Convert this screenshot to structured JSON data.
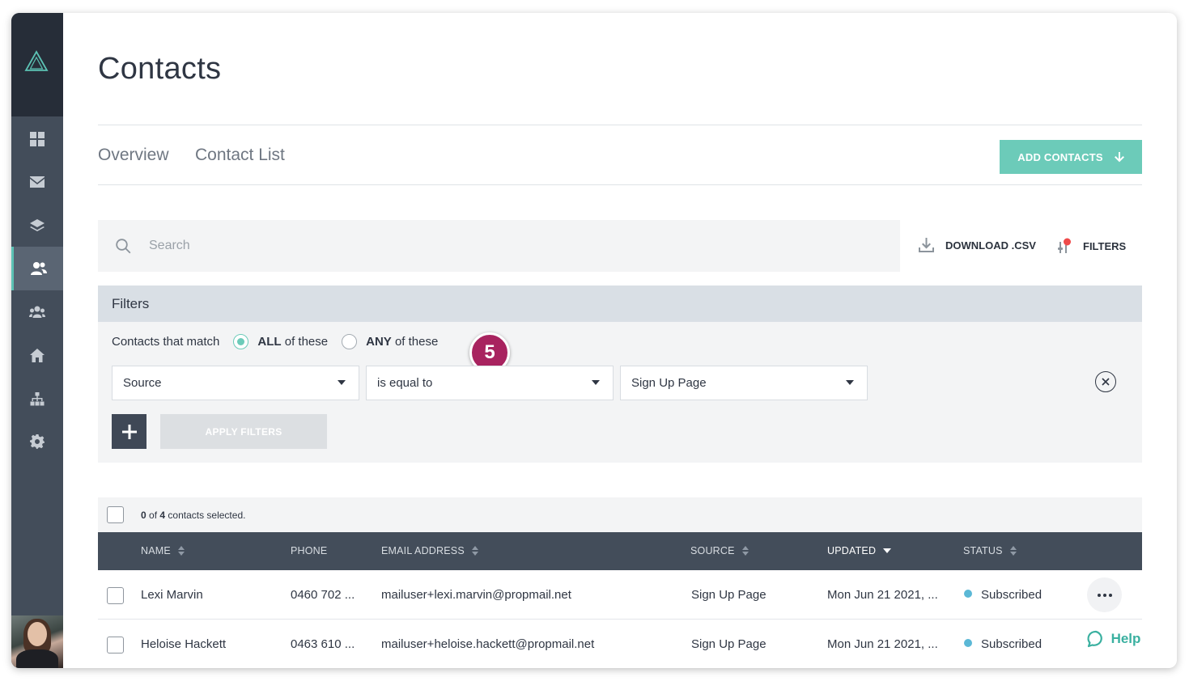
{
  "page": {
    "title": "Contacts",
    "tabs": [
      {
        "label": "Overview"
      },
      {
        "label": "Contact List"
      }
    ],
    "add_contacts_label": "ADD CONTACTS"
  },
  "sidebar": {
    "items": [
      {
        "icon": "dashboard-icon"
      },
      {
        "icon": "mail-icon"
      },
      {
        "icon": "layers-icon"
      },
      {
        "icon": "contacts-icon",
        "active": true
      },
      {
        "icon": "groups-icon"
      },
      {
        "icon": "home-icon"
      },
      {
        "icon": "sitemap-icon"
      },
      {
        "icon": "gear-icon"
      }
    ]
  },
  "toolbar": {
    "search_placeholder": "Search",
    "download_label": "DOWNLOAD .CSV",
    "filters_label": "FILTERS"
  },
  "filters": {
    "heading": "Filters",
    "match_label": "Contacts that match",
    "all_bold": "ALL",
    "all_rest": " of these",
    "any_bold": "ANY",
    "any_rest": " of these",
    "selected_match": "ALL",
    "field_value": "Source",
    "operator_value": "is equal to",
    "value_value": "Sign Up Page",
    "apply_label": "APPLY FILTERS",
    "step_badge": "5"
  },
  "selection": {
    "selected_count": "0",
    "of_text": " of ",
    "total_count": "4",
    "suffix": " contacts selected."
  },
  "table": {
    "columns": [
      {
        "label": "NAME"
      },
      {
        "label": "PHONE"
      },
      {
        "label": "EMAIL ADDRESS"
      },
      {
        "label": "SOURCE"
      },
      {
        "label": "UPDATED"
      },
      {
        "label": "STATUS"
      }
    ],
    "rows": [
      {
        "name": "Lexi Marvin",
        "phone": "0460 702 ...",
        "email": "mailuser+lexi.marvin@propmail.net",
        "source": "Sign Up Page",
        "updated": "Mon Jun 21 2021, ...",
        "status": "Subscribed"
      },
      {
        "name": "Heloise Hackett",
        "phone": "0463 610 ...",
        "email": "mailuser+heloise.hackett@propmail.net",
        "source": "Sign Up Page",
        "updated": "Mon Jun 21 2021, ...",
        "status": "Subscribed"
      }
    ]
  },
  "help": {
    "label": "Help"
  },
  "colors": {
    "accent": "#6ccbb9",
    "sidebar": "#434d5a",
    "badge": "#a8235f",
    "status_subscribed": "#5bb8d6"
  }
}
